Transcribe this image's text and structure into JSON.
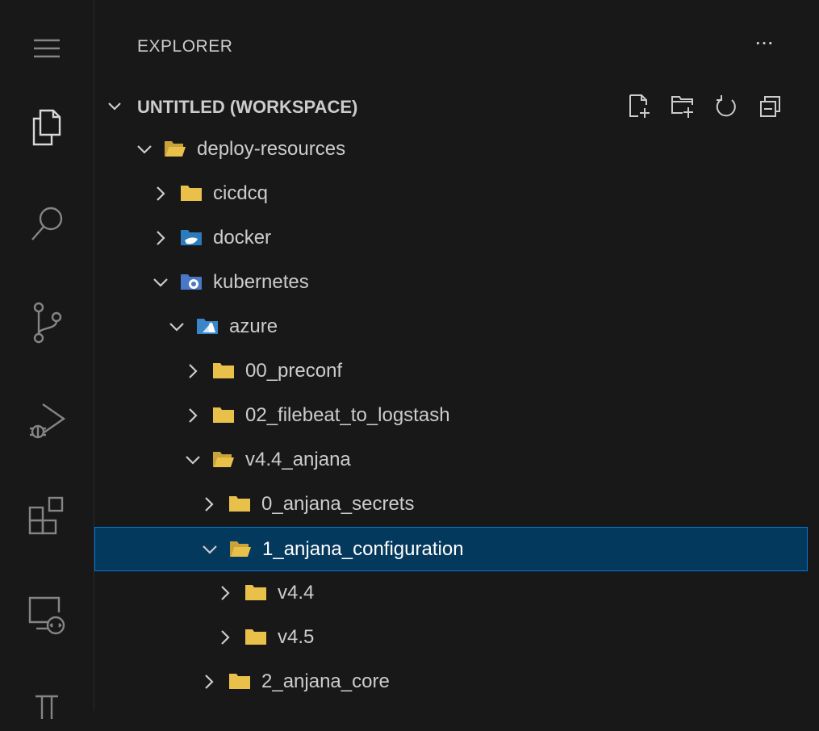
{
  "activity_bar": {
    "items": [
      {
        "icon": "menu-icon"
      },
      {
        "icon": "explorer-files-icon"
      },
      {
        "icon": "search-icon"
      },
      {
        "icon": "source-control-icon"
      },
      {
        "icon": "run-debug-icon"
      },
      {
        "icon": "extensions-icon"
      },
      {
        "icon": "remote-explorer-icon"
      },
      {
        "icon": "testing-flask-icon"
      }
    ]
  },
  "explorer": {
    "title": "EXPLORER",
    "more": "...",
    "workspace_title": "UNTITLED (WORKSPACE)",
    "actions": [
      "new-file-icon",
      "new-folder-icon",
      "refresh-icon",
      "collapse-all-icon"
    ]
  },
  "tree": [
    {
      "label": "deploy-resources",
      "expanded": true,
      "icon": "folder-open-yellow"
    },
    {
      "label": "cicdcq",
      "expanded": false,
      "icon": "folder-yellow"
    },
    {
      "label": "docker",
      "expanded": false,
      "icon": "folder-docker"
    },
    {
      "label": "kubernetes",
      "expanded": true,
      "icon": "folder-kubernetes"
    },
    {
      "label": "azure",
      "expanded": true,
      "icon": "folder-azure"
    },
    {
      "label": "00_preconf",
      "expanded": false,
      "icon": "folder-yellow"
    },
    {
      "label": "02_filebeat_to_logstash",
      "expanded": false,
      "icon": "folder-yellow"
    },
    {
      "label": "v4.4_anjana",
      "expanded": true,
      "icon": "folder-open-yellow"
    },
    {
      "label": "0_anjana_secrets",
      "expanded": false,
      "icon": "folder-yellow"
    },
    {
      "label": "1_anjana_configuration",
      "expanded": true,
      "icon": "folder-open-yellow",
      "selected": true
    },
    {
      "label": "v4.4",
      "expanded": false,
      "icon": "folder-yellow"
    },
    {
      "label": "v4.5",
      "expanded": false,
      "icon": "folder-yellow"
    },
    {
      "label": "2_anjana_core",
      "expanded": false,
      "icon": "folder-yellow"
    }
  ],
  "colors": {
    "background": "#181818",
    "selection": "#04395e",
    "selection_border": "#0078d4",
    "folder": "#e8c04a"
  }
}
